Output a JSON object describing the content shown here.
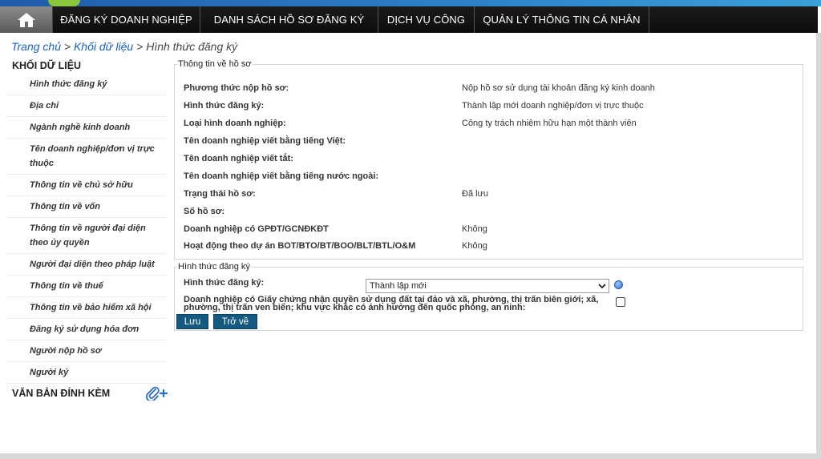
{
  "nav": {
    "home_icon": "home-icon",
    "items": [
      "ĐĂNG KÝ DOANH NGHIỆP",
      "DANH SÁCH HỒ SƠ ĐĂNG KÝ",
      "DỊCH VỤ CÔNG",
      "QUẢN LÝ THÔNG TIN CÁ NHÂN"
    ]
  },
  "breadcrumb": {
    "home": "Trang chủ",
    "sep": ">",
    "section": "Khối dữ liệu",
    "current": "Hình thức đăng ký"
  },
  "sidebar": {
    "title": "KHỐI DỮ LIỆU",
    "items": [
      "Hình thức đăng ký",
      "Địa chỉ",
      "Ngành nghề kinh doanh",
      "Tên doanh nghiệp/đơn vị trực thuộc",
      "Thông tin về chủ sở hữu",
      "Thông tin về vốn",
      "Thông tin về người đại diện theo ủy quyền",
      "Người đại diện theo pháp luật",
      "Thông tin về thuế",
      "Thông tin về bảo hiểm xã hội",
      "Đăng ký sử dụng hóa đơn",
      "Người nộp hồ sơ",
      "Người ký"
    ],
    "attachments_title": "VĂN BẢN ĐÍNH KÈM",
    "attach_icon": "paperclip-plus-icon"
  },
  "info_panel": {
    "legend": "Thông tin về hồ sơ",
    "rows": [
      {
        "label": "Phương thức nộp hồ sơ:",
        "value": "Nộp hồ sơ sử dụng tài khoản đăng ký kinh doanh"
      },
      {
        "label": "Hình thức đăng ký:",
        "value": "Thành lập mới doanh nghiệp/đơn vị trực thuộc"
      },
      {
        "label": "Loại hình doanh nghiệp:",
        "value": "Công ty trách nhiệm hữu hạn một thành viên"
      },
      {
        "label": "Tên doanh nghiệp viết bằng tiếng Việt:",
        "value": ""
      },
      {
        "label": "Tên doanh nghiệp viết tắt:",
        "value": ""
      },
      {
        "label": "Tên doanh nghiệp viết bằng tiếng nước ngoài:",
        "value": ""
      },
      {
        "label": "Trạng thái hồ sơ:",
        "value": "Đã lưu"
      },
      {
        "label": "Số hồ sơ:",
        "value": ""
      },
      {
        "label": "Doanh nghiệp có GPĐT/GCNĐKĐT",
        "value": "Không"
      },
      {
        "label": "Hoạt động theo dự án BOT/BTO/BT/BOO/BLT/BTL/O&M",
        "value": "Không"
      }
    ]
  },
  "form_panel": {
    "legend": "Hình thức đăng ký",
    "reg_type_label": "Hình thức đăng ký:",
    "reg_type_value": "Thành lập mới",
    "land_cert_label": "Doanh nghiệp có Giấy chứng nhận quyền sử dụng đất tại đảo và xã, phường, thị trấn biên giới; xã, phường, thị trấn ven biển; khu vực khác có ảnh hưởng đến quốc phòng, an ninh:",
    "land_cert_checked": false,
    "save_label": "Lưu",
    "back_label": "Trở về"
  }
}
